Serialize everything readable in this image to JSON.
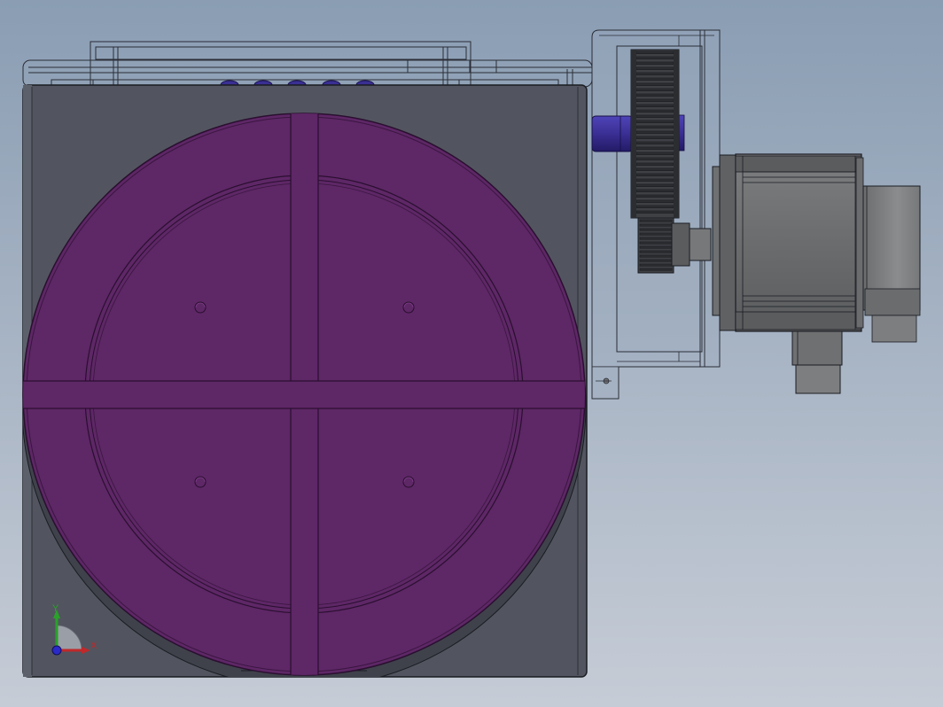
{
  "viewport": {
    "background_top": "#8a9db3",
    "background_bottom": "#c6ccd6"
  },
  "colors": {
    "housing": "#52555f",
    "housing_dark": "#3f424b",
    "housing_light": "#5c606b",
    "turntable": "#5e2766",
    "turntable_edge": "#2a0f30",
    "transparent_cover": "#9aa9be",
    "outline": "#1a1c22",
    "gear": "#3e4044",
    "gear_tooth": "#2b2d30",
    "motor": "#6e7072",
    "motor_dark": "#55575a",
    "motor_light": "#8a8c8e",
    "shaft_blue": "#3a2f93",
    "axis_x": "#c0282a",
    "axis_y": "#2aa12a",
    "axis_z": "#2a2ac8"
  },
  "triad": {
    "x_label": "X",
    "y_label": "Y"
  }
}
